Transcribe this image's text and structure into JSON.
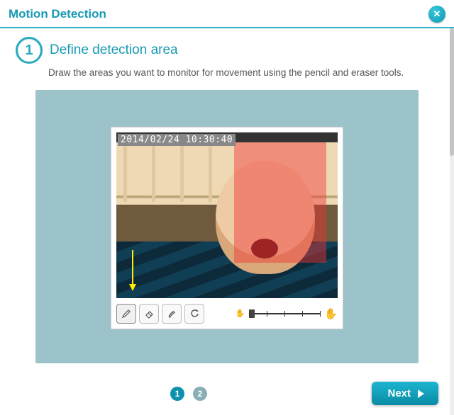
{
  "header": {
    "title": "Motion Detection"
  },
  "step": {
    "number": "1",
    "title": "Define detection area",
    "description": "Draw the areas you want to monitor for movement using the pencil and eraser tools."
  },
  "video": {
    "timestamp": "2014/02/24 10:30:40"
  },
  "tools": {
    "pencil": "pencil",
    "eraser": "eraser",
    "brush": "brush",
    "refresh": "refresh"
  },
  "pager": {
    "current": "1",
    "next": "2"
  },
  "footer": {
    "next_label": "Next"
  }
}
